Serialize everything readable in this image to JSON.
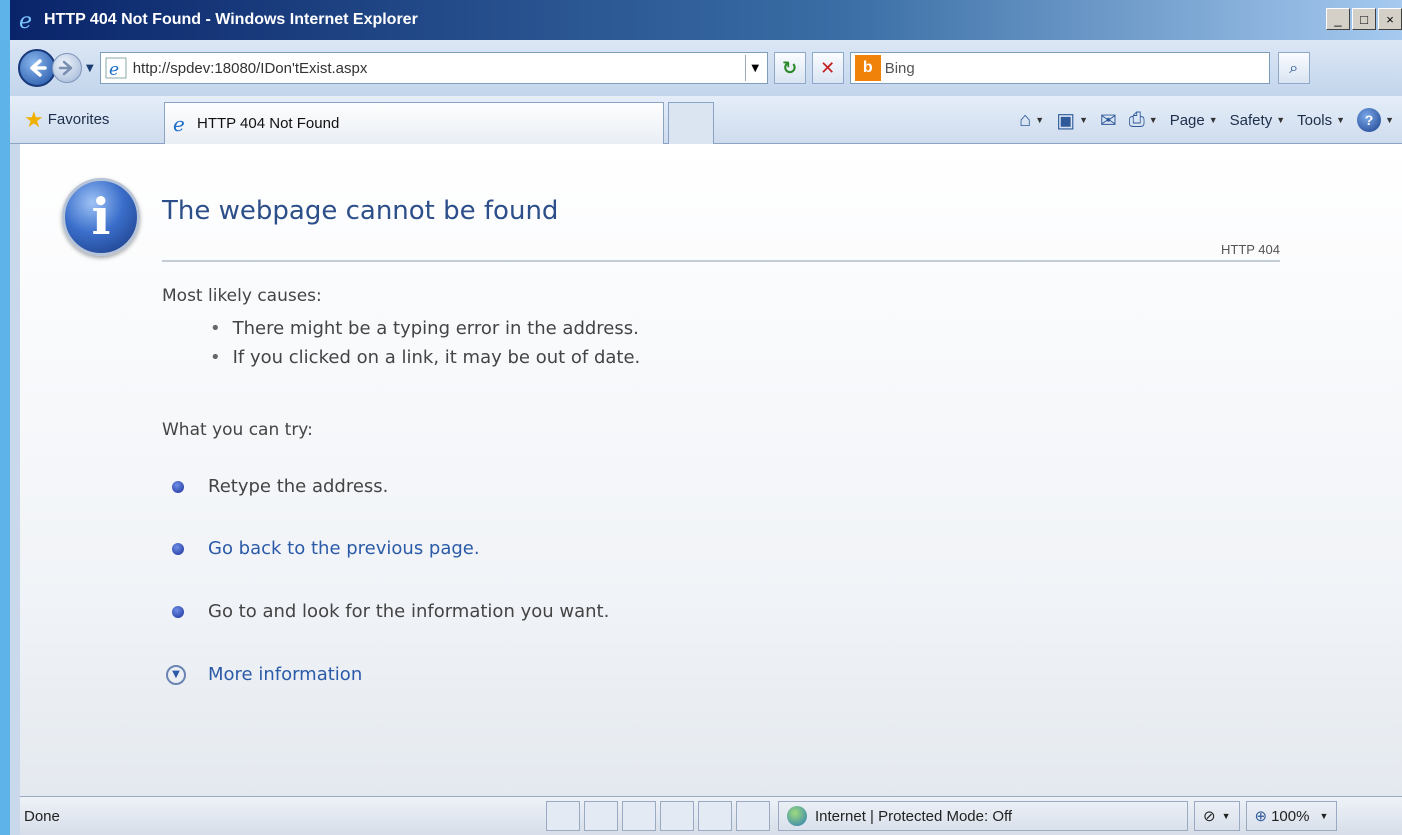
{
  "window": {
    "title": "HTTP 404 Not Found - Windows Internet Explorer",
    "controls": {
      "minimize": "_",
      "maximize": "□",
      "close": "×"
    }
  },
  "addressbar": {
    "url": "http://spdev:18080/IDon'tExist.aspx",
    "search_value": "Bing"
  },
  "commandbar": {
    "favorites_label": "Favorites",
    "tab_title": "HTTP 404 Not Found",
    "page_label": "Page",
    "safety_label": "Safety",
    "tools_label": "Tools"
  },
  "content": {
    "heading": "The webpage cannot be found",
    "code": "HTTP 404",
    "causes_label": "Most likely causes:",
    "causes": [
      "There might be a typing error in the address.",
      "If you clicked on a link, it may be out of date."
    ],
    "try_label": "What you can try:",
    "try_items": {
      "retype": "Retype the address.",
      "go_back": "Go back to the previous page.",
      "go_to": "Go to  and look for the information you want."
    },
    "more_info": "More information"
  },
  "statusbar": {
    "status": "Done",
    "zone": "Internet | Protected Mode: Off",
    "zoom": "100%"
  },
  "icons": {
    "ie_logo": "ie-logo-icon",
    "back": "back-arrow-icon",
    "forward": "forward-arrow-icon",
    "refresh": "refresh-icon",
    "stop": "stop-icon",
    "bing": "bing-icon",
    "search": "magnifier-icon",
    "favorites": "star-icon",
    "home": "home-icon",
    "feeds": "rss-icon",
    "mail": "mail-icon",
    "print": "printer-icon",
    "help": "help-icon",
    "info": "info-icon",
    "globe": "globe-icon"
  }
}
